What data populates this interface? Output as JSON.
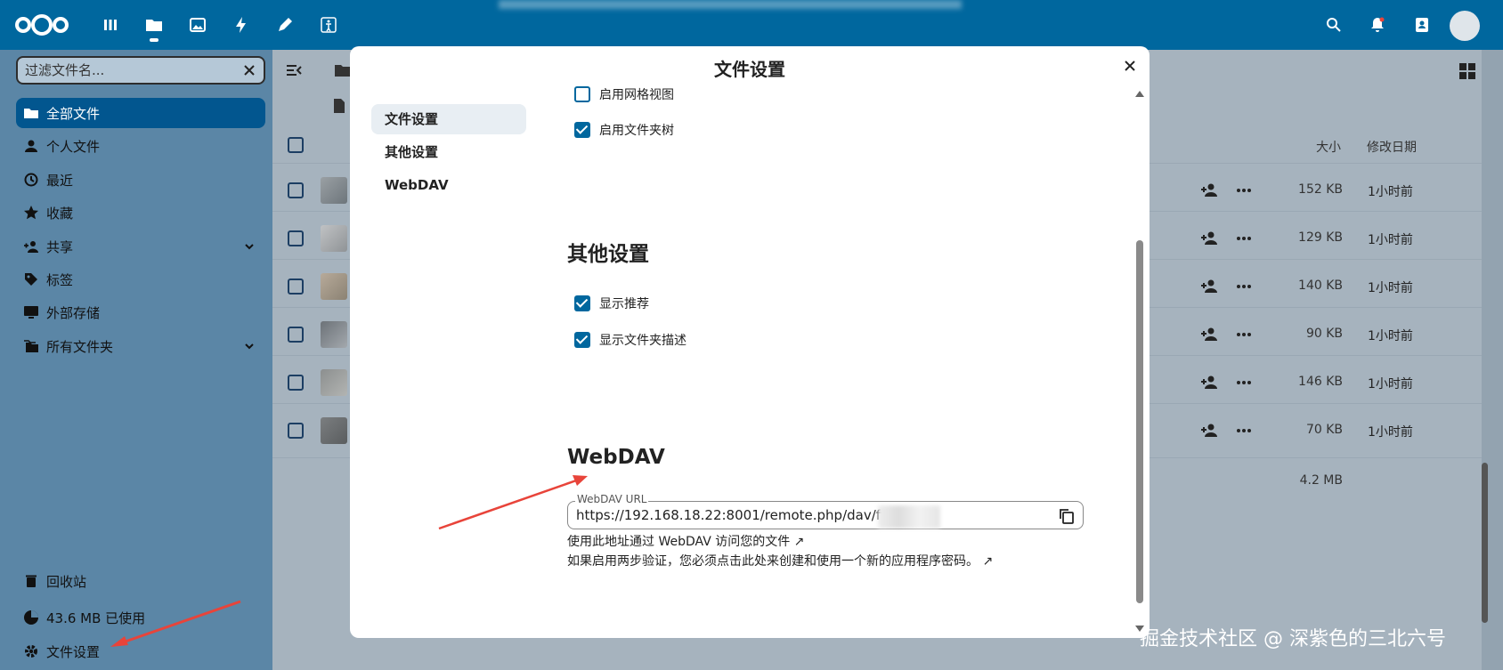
{
  "topbar": {
    "apps": [
      "dashboard",
      "files",
      "photos",
      "activity",
      "notes",
      "accessibility"
    ]
  },
  "sidebar": {
    "filter_placeholder": "过滤文件名...",
    "items": [
      {
        "label": "全部文件",
        "icon": "folder-icon",
        "active": true
      },
      {
        "label": "个人文件",
        "icon": "person-icon"
      },
      {
        "label": "最近",
        "icon": "history-icon"
      },
      {
        "label": "收藏",
        "icon": "star-icon"
      },
      {
        "label": "共享",
        "icon": "share-icon",
        "expandable": true
      },
      {
        "label": "标签",
        "icon": "tag-icon"
      },
      {
        "label": "外部存储",
        "icon": "external-storage-icon"
      },
      {
        "label": "所有文件夹",
        "icon": "folders-icon",
        "expandable": true
      }
    ],
    "bottom": {
      "trash": "回收站",
      "quota": "43.6 MB 已使用",
      "settings": "文件设置"
    }
  },
  "file_list": {
    "headers": {
      "size": "大小",
      "modified": "修改日期"
    },
    "rows": [
      {
        "size": "152 KB",
        "modified": "1小时前"
      },
      {
        "size": "129 KB",
        "modified": "1小时前"
      },
      {
        "size": "140 KB",
        "modified": "1小时前"
      },
      {
        "size": "90 KB",
        "modified": "1小时前"
      },
      {
        "size": "146 KB",
        "modified": "1小时前"
      },
      {
        "size": "70 KB",
        "modified": "1小时前"
      }
    ],
    "total_size": "4.2 MB"
  },
  "modal": {
    "title": "文件设置",
    "nav": [
      {
        "label": "文件设置",
        "active": true
      },
      {
        "label": "其他设置"
      },
      {
        "label": "WebDAV"
      }
    ],
    "file_settings": {
      "grid_view_label": "启用网格视图",
      "grid_view_checked": false,
      "folder_tree_label": "启用文件夹树",
      "folder_tree_checked": true
    },
    "other_settings": {
      "title": "其他设置",
      "recommendations_label": "显示推荐",
      "recommendations_checked": true,
      "folder_desc_label": "显示文件夹描述",
      "folder_desc_checked": true
    },
    "webdav": {
      "title": "WebDAV",
      "url_label": "WebDAV URL",
      "url_value": "https://192.168.18.22:8001/remote.php/dav/files",
      "hint1": "使用此地址通过 WebDAV 访问您的文件 ↗",
      "hint2": "如果启用两步验证，您必须点击此处来创建和使用一个新的应用程序密码。 ↗"
    }
  },
  "watermark": "掘金技术社区 @ 深紫色的三北六号",
  "colors": {
    "primary": "#00679e",
    "arrow": "#e8443a"
  }
}
